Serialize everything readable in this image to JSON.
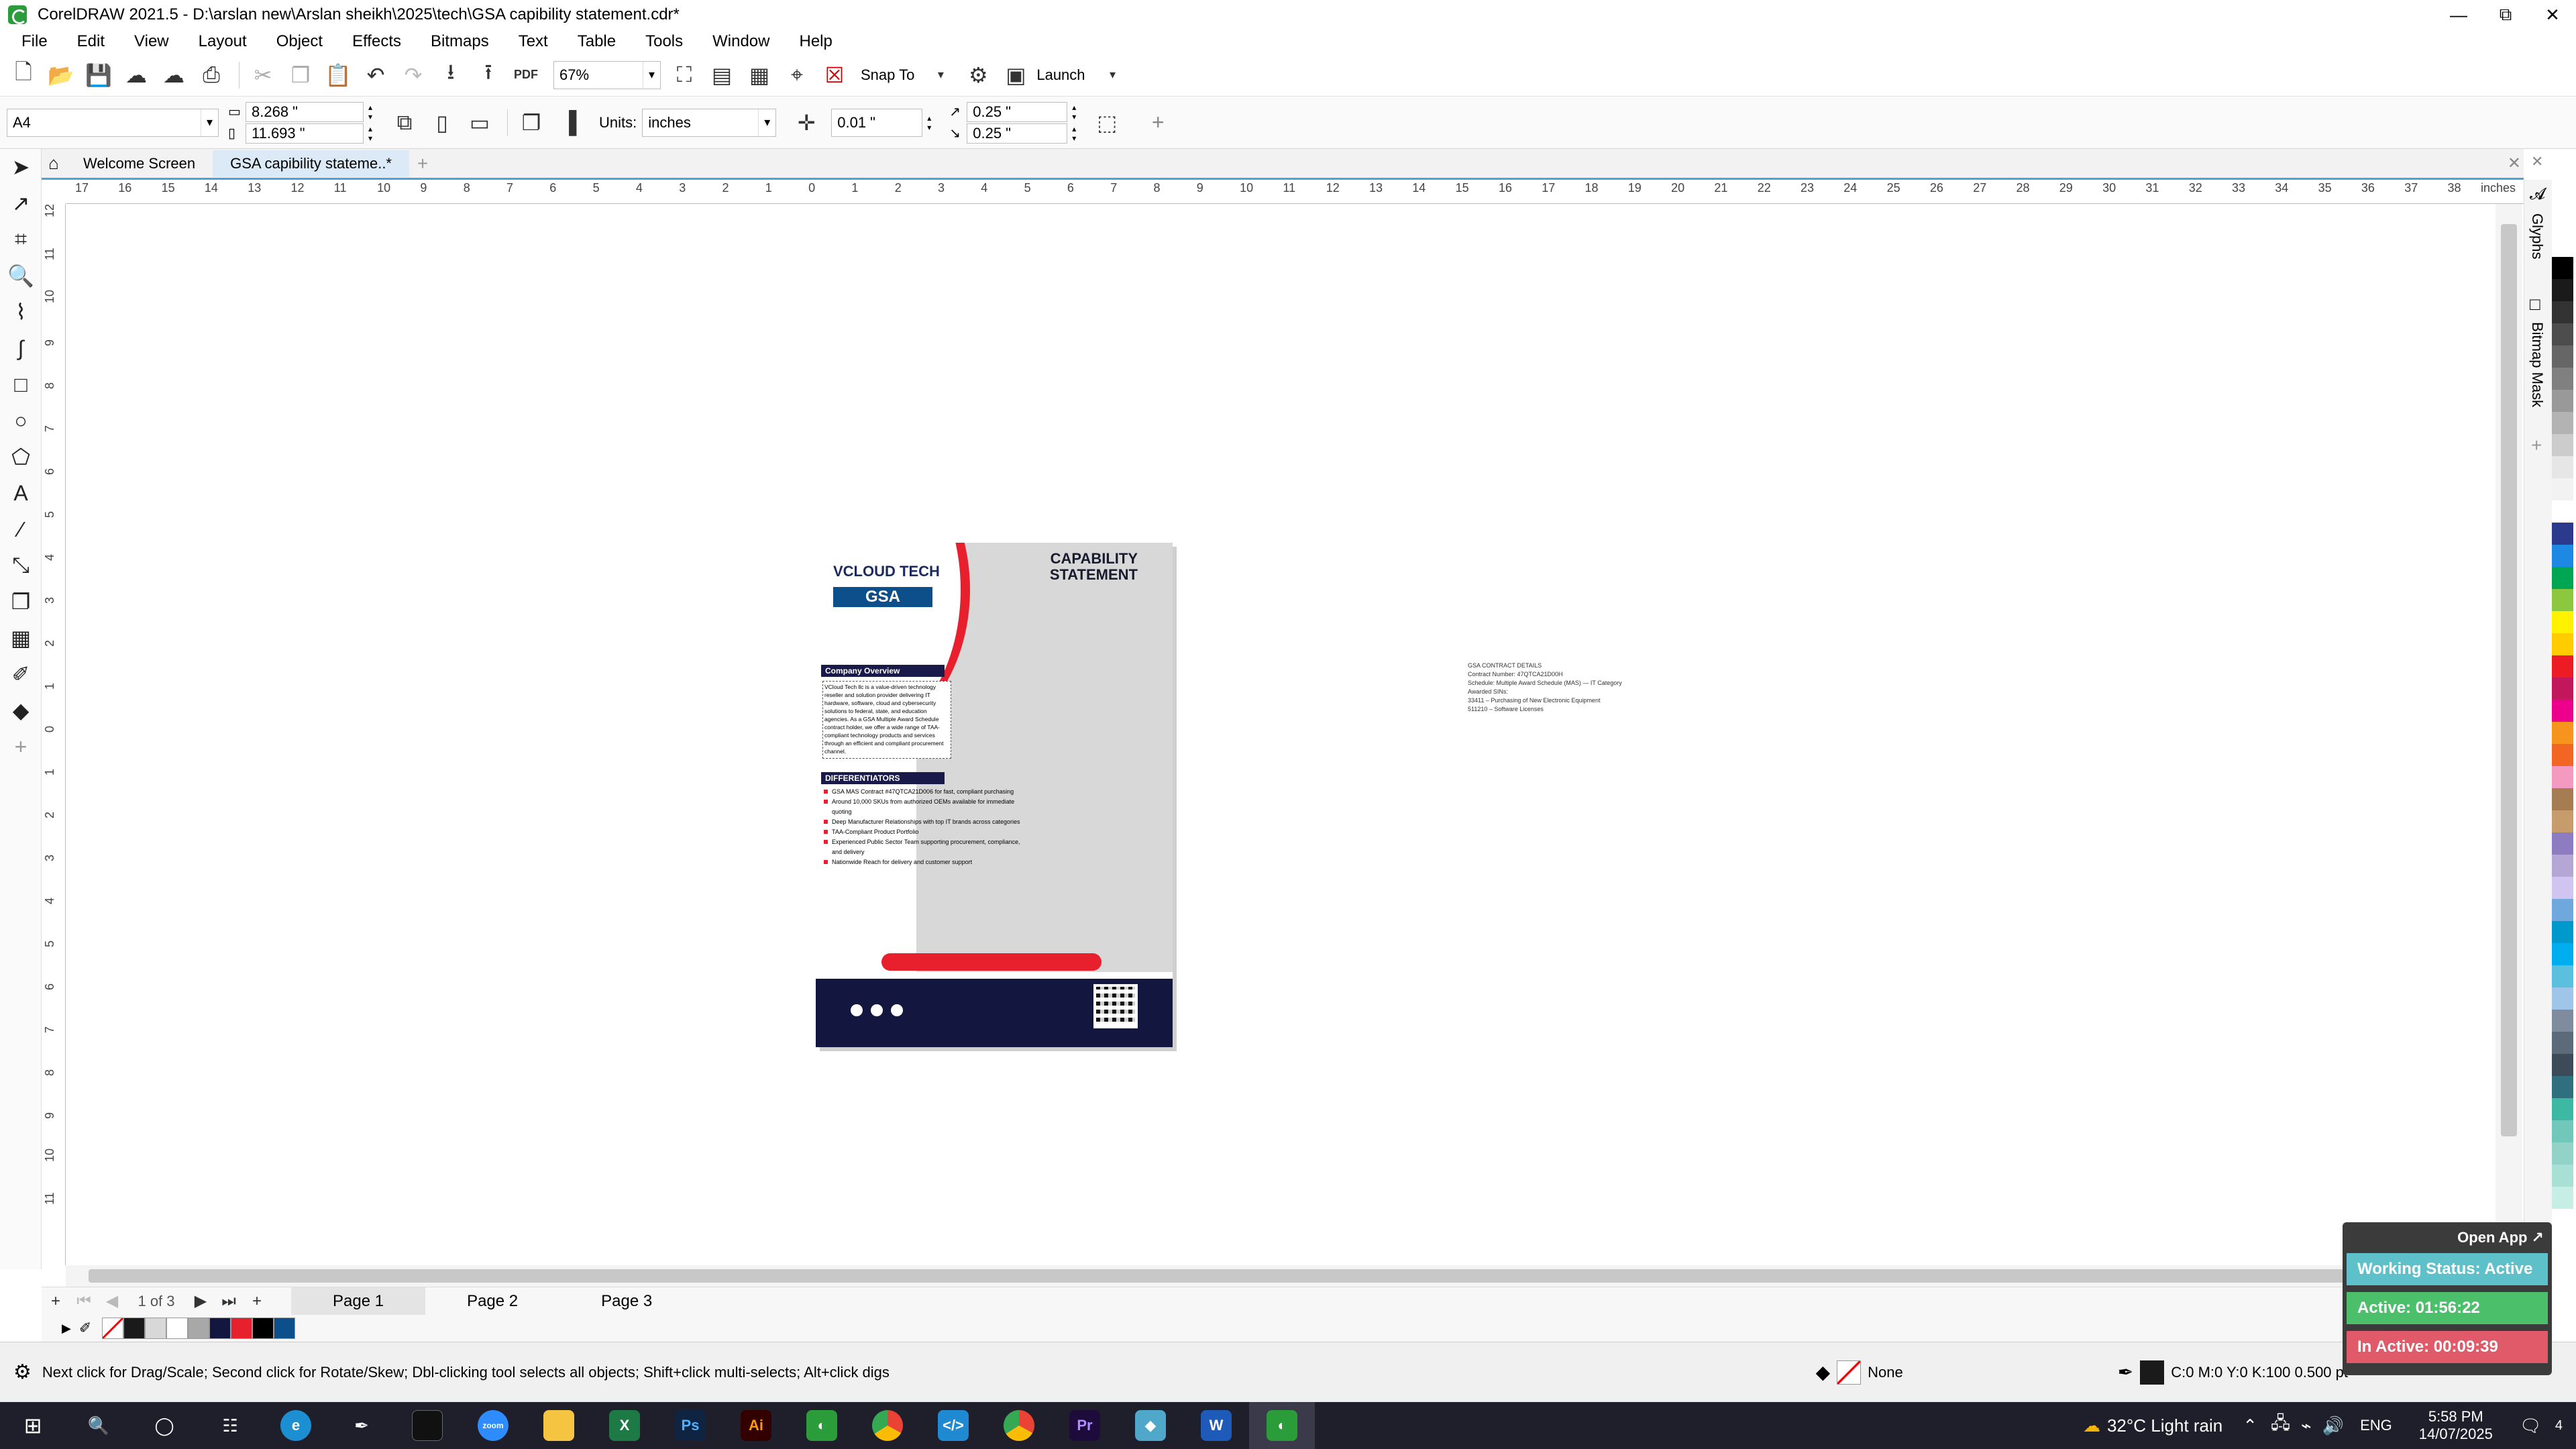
{
  "titlebar": {
    "title": "CorelDRAW 2021.5 - D:\\arslan new\\Arslan sheikh\\2025\\tech\\GSA   capibility statement.cdr*",
    "minimize": "—",
    "maximize": "⧉",
    "close": "✕"
  },
  "menu": [
    "File",
    "Edit",
    "View",
    "Layout",
    "Object",
    "Effects",
    "Bitmaps",
    "Text",
    "Table",
    "Tools",
    "Window",
    "Help"
  ],
  "toolbar": {
    "zoom": "67%",
    "snap_to": "Snap To",
    "launch": "Launch",
    "pdf_label": "PDF"
  },
  "propbar": {
    "page_size": "A4",
    "width": "8.268 \"",
    "height": "11.693 \"",
    "units_label": "Units:",
    "units": "inches",
    "nudge": "0.01 \"",
    "dup_x": "0.25 \"",
    "dup_y": "0.25 \""
  },
  "tabs": {
    "welcome": "Welcome Screen",
    "document": "GSA   capibility stateme..*"
  },
  "ruler": {
    "h_labels": [
      "17",
      "16",
      "15",
      "14",
      "13",
      "12",
      "11",
      "10",
      "9",
      "8",
      "7",
      "6",
      "5",
      "4",
      "3",
      "2",
      "1",
      "0",
      "1",
      "2",
      "3",
      "4",
      "5",
      "6",
      "7",
      "8",
      "9",
      "10",
      "11",
      "12",
      "13",
      "14",
      "15",
      "16",
      "17",
      "18",
      "19",
      "20",
      "21",
      "22",
      "23",
      "24",
      "25",
      "26",
      "27",
      "28",
      "29",
      "30",
      "31",
      "32",
      "33",
      "34",
      "35",
      "36",
      "37",
      "38"
    ],
    "unit": "inches"
  },
  "document_page": {
    "logo_main": "VCLOUD TECH",
    "badge": "GSA",
    "title_line1": "CAPABILITY",
    "title_line2": "STATEMENT",
    "overview_header": "Company Overview",
    "overview_text": "VCloud Tech llc is a value-driven technology reseller and solution provider delivering IT hardware, software, cloud and cybersecurity solutions to federal, state, and education agencies. As a GSA Multiple Award Schedule contract holder, we offer a wide range of TAA-compliant technology products and services through an efficient and compliant procurement channel.",
    "diff_header": "DIFFERENTIATORS",
    "differentiators": [
      "GSA MAS Contract #47QTCA21D006 for fast, compliant purchasing",
      "Around 10,000 SKUs from authorized OEMs available for immediate quoting",
      "Deep Manufacturer Relationships with top IT brands across categories",
      "TAA-Compliant Product Portfolio",
      "Experienced Public Sector Team supporting procurement, compliance, and delivery",
      "Nationwide Reach for delivery and customer support"
    ]
  },
  "contract_block": [
    "GSA CONTRACT DETAILS",
    "Contract Number: 47QTCA21D00H",
    "Schedule: Multiple Award Schedule (MAS) — IT Category",
    "Awarded SINs:",
    " 33411 – Purchasing of New Electronic Equipment",
    " 511210 – Software Licenses"
  ],
  "pagetabs": {
    "counter": "1 of 3",
    "pages": [
      "Page 1",
      "Page 2",
      "Page 3"
    ]
  },
  "docker_tabs": [
    "Glyphs",
    "Bitmap Mask"
  ],
  "status": {
    "hint": "Next click for Drag/Scale; Second click for Rotate/Skew; Dbl-clicking tool selects all objects; Shift+click multi-selects; Alt+click digs",
    "fill": "None",
    "outline": "C:0 M:0 Y:0 K:100  0.500 pt"
  },
  "tracker": {
    "open_app": "Open App ↗",
    "working": "Working Status: Active",
    "active": "Active: 01:56:22",
    "inactive": "In Active: 00:09:39"
  },
  "taskbar": {
    "weather": "32°C  Light rain",
    "lang": "ENG",
    "time": "5:58 PM",
    "date": "14/07/2025",
    "notif": "4"
  },
  "colors": {
    "accent": "#4aa3df",
    "red": "#e81f2c",
    "navy": "#13163f",
    "green": "#4cbf6b",
    "pink": "#e05a6a"
  }
}
